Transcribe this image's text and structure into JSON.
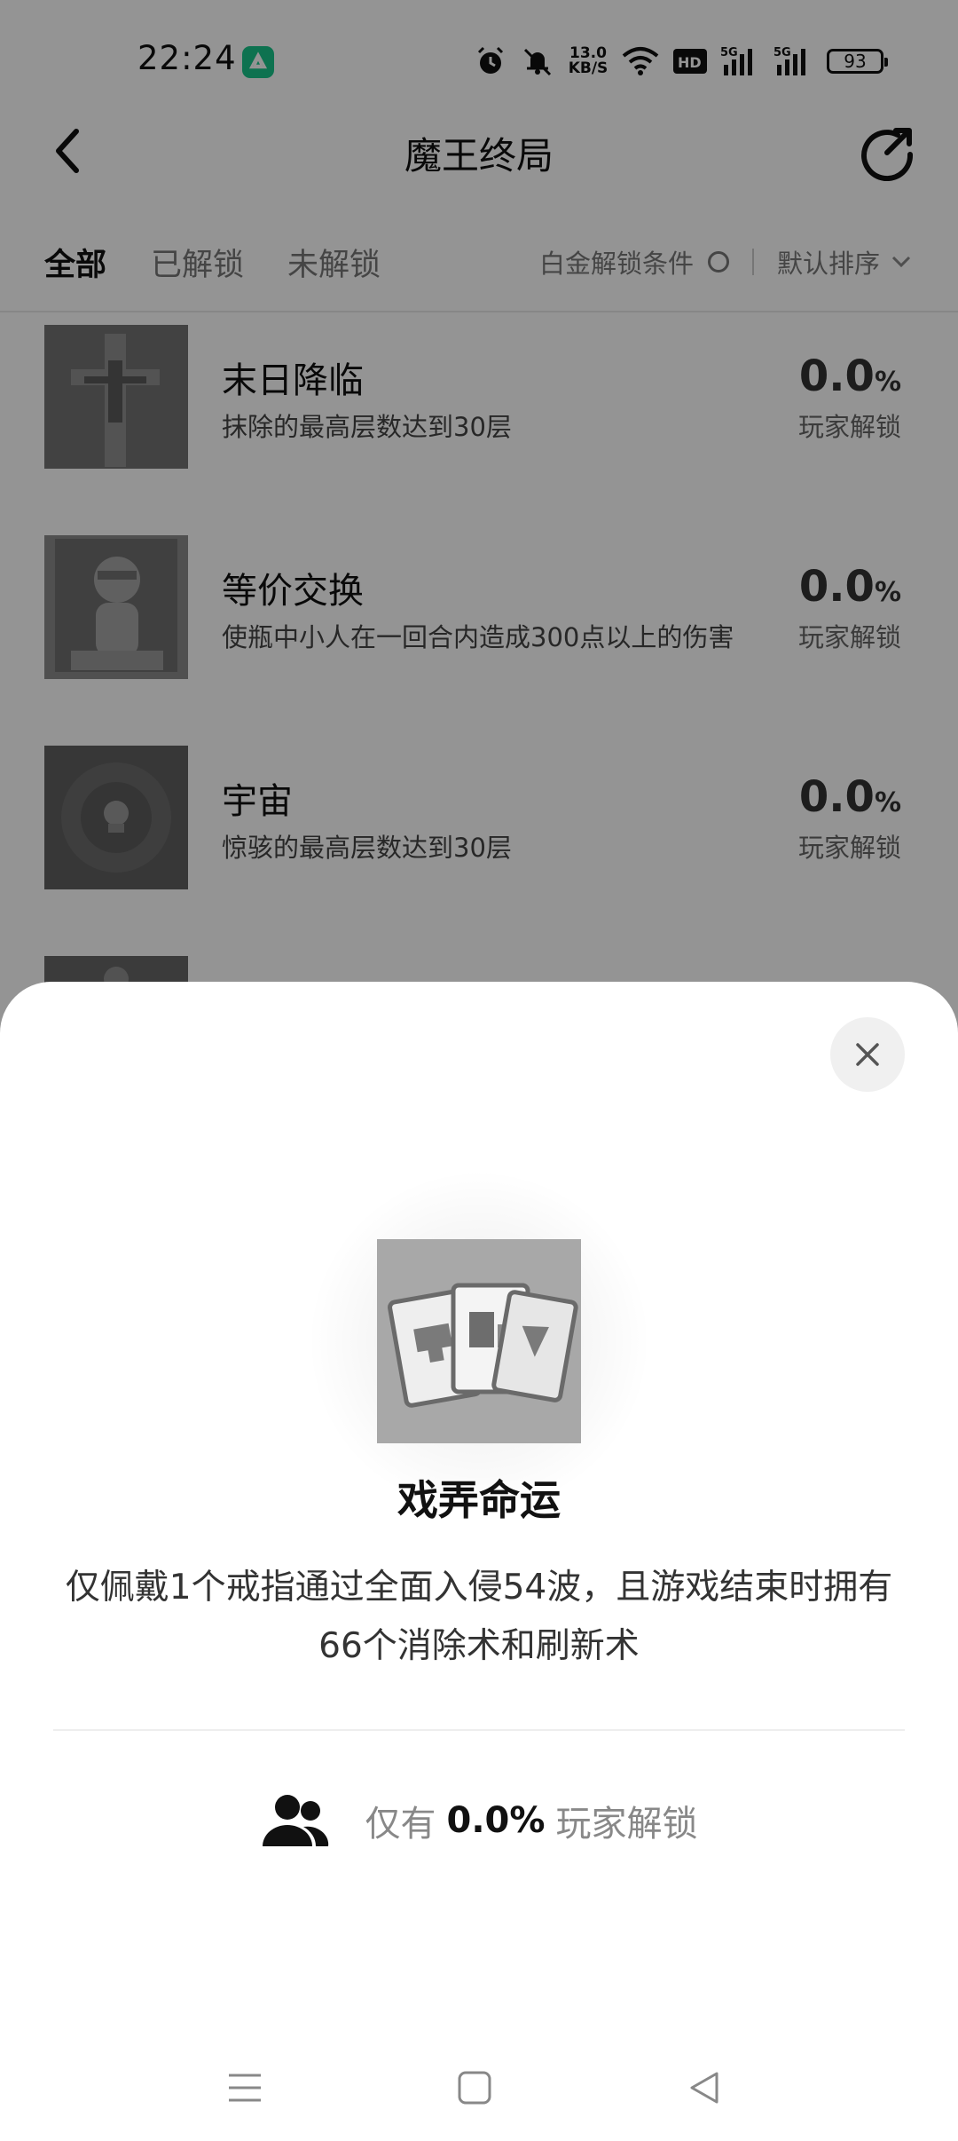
{
  "status_bar": {
    "time": "22:24",
    "app_icon": "leaf-app-icon",
    "icons": [
      "alarm-icon",
      "mute-icon",
      "wifi-icon",
      "hd-icon",
      "signal-5g-icon",
      "signal-5g-icon"
    ],
    "net_speed_value": "13.0",
    "net_speed_unit": "KB/S",
    "battery": "93"
  },
  "header": {
    "title": "魔王终局",
    "back_icon": "chevron-left-icon",
    "share_icon": "share-icon"
  },
  "tabs": {
    "items": [
      {
        "label": "全部",
        "active": true
      },
      {
        "label": "已解锁",
        "active": false
      },
      {
        "label": "未解锁",
        "active": false
      }
    ],
    "platinum_label": "白金解锁条件",
    "sort_label": "默认排序"
  },
  "achievements": [
    {
      "title": "末日降临",
      "desc": "抹除的最高层数达到30层",
      "percent": "0.0",
      "percent_unit": "%",
      "rate_label": "玩家解锁"
    },
    {
      "title": "等价交换",
      "desc": "使瓶中小人在一回合内造成300点以上的伤害",
      "percent": "0.0",
      "percent_unit": "%",
      "rate_label": "玩家解锁"
    },
    {
      "title": "宇宙",
      "desc": "惊骇的最高层数达到30层",
      "percent": "0.0",
      "percent_unit": "%",
      "rate_label": "玩家解锁"
    }
  ],
  "sheet": {
    "close_icon": "close-icon",
    "title": "戏弄命运",
    "description": "仅佩戴1个戒指通过全面入侵54波，且游戏结束时拥有66个消除术和刷新术",
    "stat_prefix": "仅有",
    "stat_value": "0.0%",
    "stat_suffix": "玩家解锁",
    "stat_icon": "people-icon"
  },
  "nav_bar": {
    "icons": [
      "menu-icon",
      "home-icon",
      "back-triangle-icon"
    ]
  }
}
